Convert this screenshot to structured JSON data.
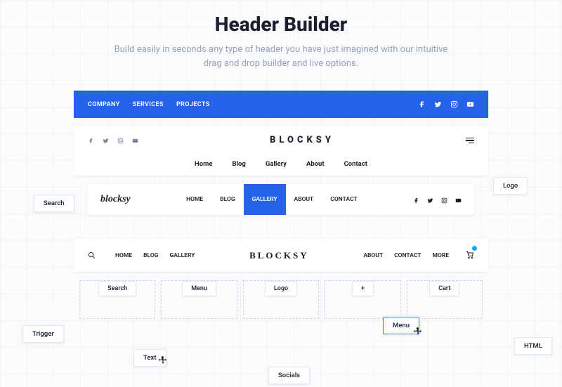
{
  "hero": {
    "title": "Header Builder",
    "subtitle": "Build easily in seconds any type of header you have just imagined with our intuitive drag and drop builder and live options."
  },
  "example1": {
    "links": [
      "COMPANY",
      "SERVICES",
      "PROJECTS"
    ]
  },
  "example2": {
    "brand": "BLOCKSY",
    "nav": [
      "Home",
      "Blog",
      "Gallery",
      "About",
      "Contact"
    ]
  },
  "example3": {
    "brand": "blocksy",
    "nav": [
      "HOME",
      "BLOG",
      "GALLERY",
      "ABOUT",
      "CONTACT"
    ],
    "active": "GALLERY"
  },
  "example4": {
    "brand": "BLOCKSY",
    "nav_left": [
      "HOME",
      "BLOG",
      "GALLERY"
    ],
    "nav_right": [
      "ABOUT",
      "CONTACT",
      "MORE"
    ]
  },
  "drop_zones": [
    "Search",
    "Menu",
    "Logo",
    "+",
    "Cart"
  ],
  "chips": {
    "search": "Search",
    "logo": "Logo",
    "trigger": "Trigger",
    "text": "Text",
    "socials": "Socials",
    "menu": "Menu",
    "html": "HTML"
  }
}
